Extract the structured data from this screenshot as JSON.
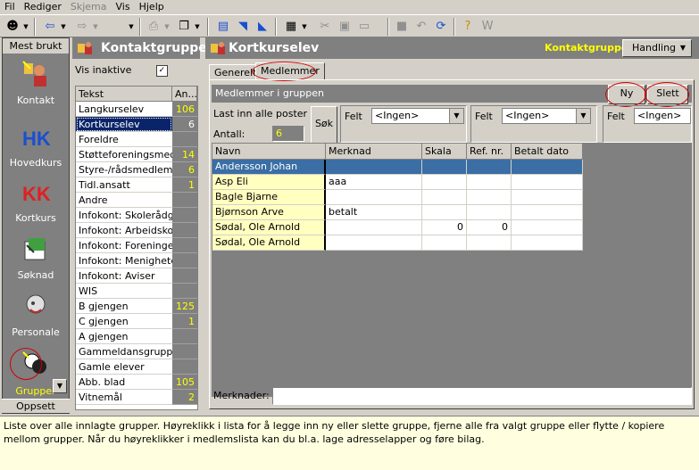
{
  "menu": [
    "Fil",
    "Rediger",
    "Skjema",
    "Vis",
    "Hjelp"
  ],
  "nav": {
    "title": "Mest brukt",
    "items": [
      {
        "label": "Kontakt",
        "icon": "contact-icon"
      },
      {
        "label": "Hovedkurs",
        "icon": "hk-icon"
      },
      {
        "label": "Kortkurs",
        "icon": "kk-icon"
      },
      {
        "label": "Søknad",
        "icon": "application-icon"
      },
      {
        "label": "Personale",
        "icon": "personnel-icon"
      },
      {
        "label": "Grupper",
        "icon": "groups-icon"
      }
    ],
    "bottom": "Oppsett"
  },
  "groups": {
    "title": "Kontaktgrupper",
    "inactive_label": "Vis inaktive",
    "inactive_checked": "✓",
    "col_text": "Tekst",
    "col_count": "An...",
    "rows": [
      {
        "name": "Langkurselev",
        "count": "106"
      },
      {
        "name": "Kortkurselev",
        "count": "6"
      },
      {
        "name": "Foreldre",
        "count": ""
      },
      {
        "name": "Støtteforeningsmedlem",
        "count": "14"
      },
      {
        "name": "Styre-/rådsmedlem",
        "count": "6"
      },
      {
        "name": "Tidl.ansatt",
        "count": "1"
      },
      {
        "name": "Andre",
        "count": ""
      },
      {
        "name": "Infokont: Skolerådgiver",
        "count": ""
      },
      {
        "name": "Infokont: Arbeidskontor",
        "count": ""
      },
      {
        "name": "Infokont: Foreninger",
        "count": ""
      },
      {
        "name": "Infokont: Menigheter",
        "count": ""
      },
      {
        "name": "Infokont: Aviser",
        "count": ""
      },
      {
        "name": "WIS",
        "count": ""
      },
      {
        "name": "B gjengen",
        "count": "125"
      },
      {
        "name": "C gjengen",
        "count": "1"
      },
      {
        "name": "A gjengen",
        "count": ""
      },
      {
        "name": "Gammeldansgruppa",
        "count": ""
      },
      {
        "name": "Gamle elever",
        "count": ""
      },
      {
        "name": "Abb. blad",
        "count": "105"
      },
      {
        "name": "Vitnemål",
        "count": "2"
      }
    ]
  },
  "main": {
    "title": "Kortkurselev",
    "tab_context": "Kontaktgruppe",
    "handling": "Handling",
    "tabs": [
      "Generelt",
      "Medlemmer"
    ],
    "members_title": "Medlemmer i gruppen",
    "btn_new": "Ny",
    "btn_delete": "Slett",
    "load_all_label": "Last inn alle poster",
    "load_all_checked": "✓",
    "search_label": "Søk",
    "count_label": "Antall:",
    "count_value": "6",
    "filters": [
      {
        "label": "Felt",
        "value": "<Ingen>"
      },
      {
        "label": "Felt",
        "value": "<Ingen>"
      },
      {
        "label": "Felt",
        "value": "<Ingen>"
      }
    ],
    "columns": [
      "Navn",
      "Merknad",
      "Skala",
      "Ref. nr.",
      "Betalt dato"
    ],
    "members": [
      {
        "name": "Andersson Johan",
        "note": "",
        "scale": "",
        "ref": "",
        "paid": ""
      },
      {
        "name": "Asp Eli",
        "note": "aaa",
        "scale": "",
        "ref": "",
        "paid": ""
      },
      {
        "name": "Bagle Bjarne",
        "note": "",
        "scale": "",
        "ref": "",
        "paid": ""
      },
      {
        "name": "Bjørnson Arve",
        "note": "betalt",
        "scale": "",
        "ref": "",
        "paid": ""
      },
      {
        "name": "Sødal, Ole Arnold",
        "note": "",
        "scale": "0",
        "ref": "0",
        "paid": ""
      },
      {
        "name": "Sødal, Ole Arnold",
        "note": "",
        "scale": "",
        "ref": "",
        "paid": ""
      }
    ],
    "notes_label": "Merknader:"
  },
  "status": "Liste over alle innlagte grupper. Høyreklikk i lista for å legge inn ny eller slette gruppe, fjerne alle fra valgt gruppe eller flytte / kopiere mellom grupper. Når du høyreklikker i medlemslista kan du bl.a. lage adresselapper og føre bilag.",
  "colors": {
    "selection": "#0a246a",
    "count_text": "#ffff00",
    "name_col": "#ffffc0",
    "highlight_circle": "#d00000"
  }
}
